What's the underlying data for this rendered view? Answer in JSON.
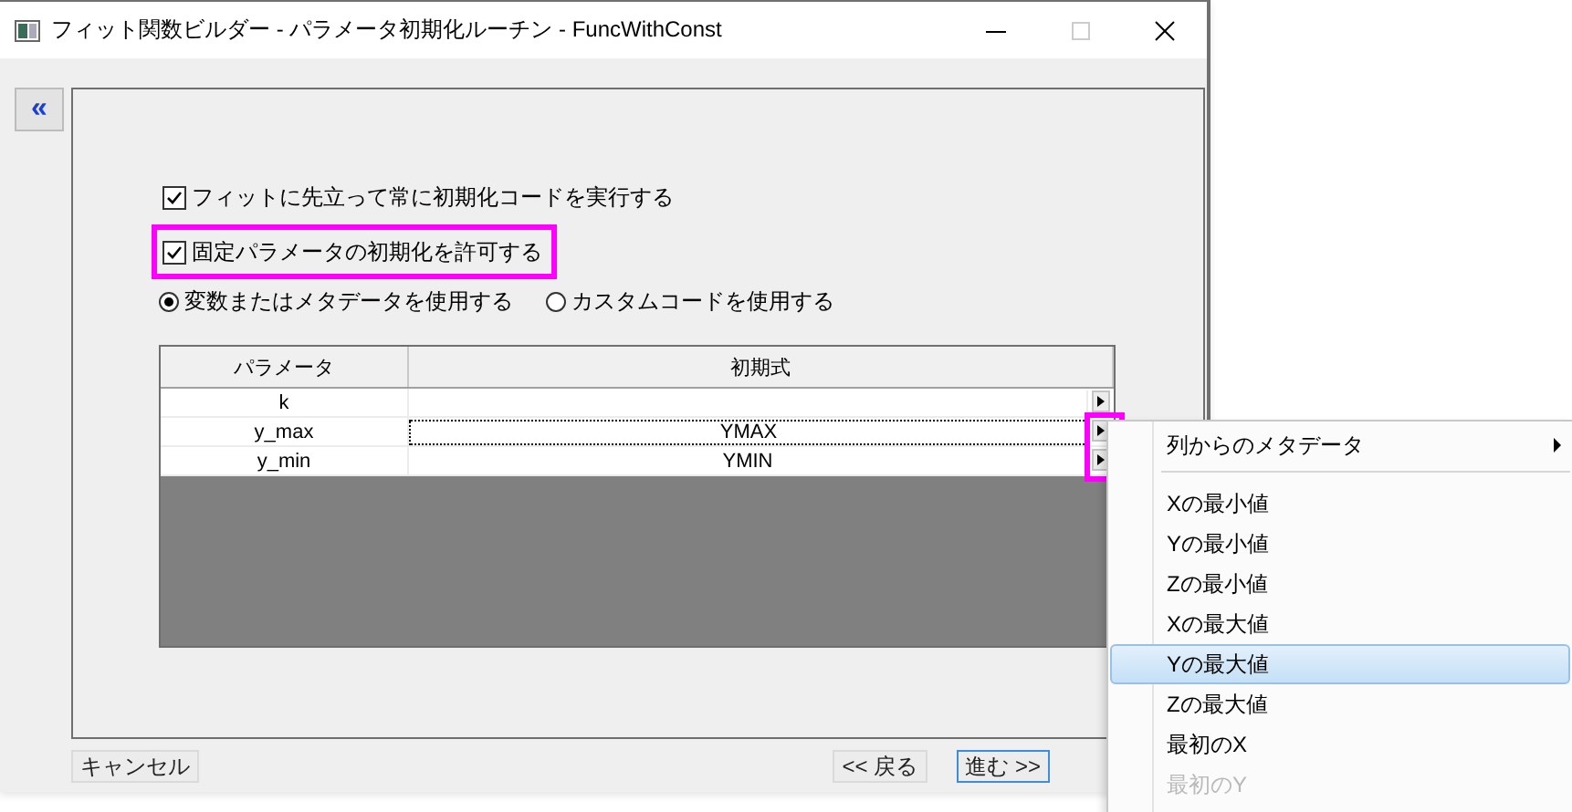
{
  "window": {
    "title": "フィット関数ビルダー - パラメータ初期化ルーチン - FuncWithConst"
  },
  "collapse_button": "«",
  "options": [
    {
      "label": "フィットに先立って常に初期化コードを実行する",
      "checked": true,
      "highlighted": false
    },
    {
      "label": "固定パラメータの初期化を許可する",
      "checked": true,
      "highlighted": true
    }
  ],
  "radios": [
    {
      "label": "変数またはメタデータを使用する",
      "selected": true
    },
    {
      "label": "カスタムコードを使用する",
      "selected": false
    }
  ],
  "table": {
    "columns": [
      "パラメータ",
      "初期式"
    ],
    "rows": [
      {
        "parameter": "k",
        "expression": "",
        "focused": false,
        "highlighted": false
      },
      {
        "parameter": "y_max",
        "expression": "YMAX",
        "focused": true,
        "highlighted": true
      },
      {
        "parameter": "y_min",
        "expression": "YMIN",
        "focused": false,
        "highlighted": true
      }
    ]
  },
  "buttons": [
    {
      "label": "キャンセル",
      "default": false
    },
    {
      "label": "<< 戻る",
      "default": false
    },
    {
      "label": "進む >>",
      "default": true
    }
  ],
  "menu": [
    {
      "kind": "submenu",
      "label": "列からのメタデータ",
      "selected": false,
      "disabled": false
    },
    {
      "kind": "separator"
    },
    {
      "kind": "item",
      "label": "Xの最小値",
      "selected": false,
      "disabled": false
    },
    {
      "kind": "item",
      "label": "Yの最小値",
      "selected": false,
      "disabled": false
    },
    {
      "kind": "item",
      "label": "Zの最小値",
      "selected": false,
      "disabled": false
    },
    {
      "kind": "item",
      "label": "Xの最大値",
      "selected": false,
      "disabled": false
    },
    {
      "kind": "item",
      "label": "Yの最大値",
      "selected": true,
      "disabled": false
    },
    {
      "kind": "item",
      "label": "Zの最大値",
      "selected": false,
      "disabled": false
    },
    {
      "kind": "item",
      "label": "最初のX",
      "selected": false,
      "disabled": false
    },
    {
      "kind": "item",
      "label": "最初のY",
      "selected": false,
      "disabled": true
    }
  ]
}
